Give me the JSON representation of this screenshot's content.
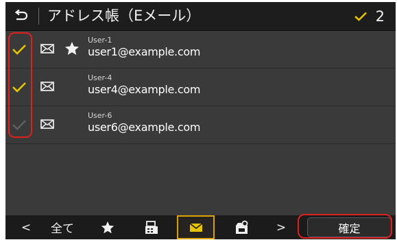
{
  "header": {
    "title": "アドレス帳（Eメール）",
    "selected_count": "2",
    "colors": {
      "check": "#e8c400",
      "background": "#1d1d1d",
      "text": "#f0f0f0"
    }
  },
  "entries": [
    {
      "name": "User-1",
      "email": "user1@example.com",
      "checked": true,
      "favorite": true
    },
    {
      "name": "User-4",
      "email": "user4@example.com",
      "checked": true,
      "favorite": false
    },
    {
      "name": "User-6",
      "email": "user6@example.com",
      "checked": false,
      "favorite": false
    }
  ],
  "toolbar": {
    "prev_label": "<",
    "all_label": "全て",
    "next_label": ">",
    "confirm_label": "確定",
    "icons": [
      "star-icon",
      "fax-icon",
      "mail-icon",
      "shared-folder-icon"
    ],
    "active_tab": "mail-icon",
    "colors": {
      "active_border": "#d9a400"
    }
  },
  "annotations": {
    "highlight_color": "#e0201e"
  }
}
